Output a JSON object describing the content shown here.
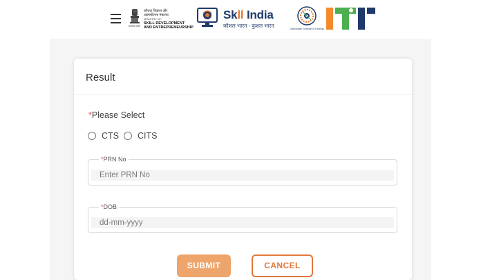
{
  "header": {
    "menu_icon": "hamburger-menu-icon",
    "ministry_logo": {
      "hindi_line1": "कौशल विकास और",
      "hindi_line2": "उद्यमशीलता मंत्रालय",
      "english_line1": "MINISTRY OF",
      "english_line2": "SKILL DEVELOPMENT",
      "english_line3": "AND ENTREPRENEURSHIP",
      "motto": "सत्यमेव जयते"
    },
    "skill_india_logo": {
      "title_part1": "Sk",
      "title_part2": "ll",
      "title_part3": " India",
      "subtitle": "कौशल भारत - कुशल भारत"
    },
    "dgt_logo": {
      "caption": "Directorate General of Training"
    },
    "iti_logo": {
      "text": "ITI",
      "colors": [
        "#f28a2e",
        "#4caf50",
        "#1f3a6b"
      ]
    }
  },
  "card": {
    "title": "Result",
    "please_select_required": "*",
    "please_select_label": "Please Select",
    "radio_options": [
      "CTS",
      "CITS"
    ],
    "prn_field": {
      "required": "*",
      "label": "PRN No",
      "placeholder": "Enter PRN No"
    },
    "dob_field": {
      "required": "*",
      "label": "DOB",
      "placeholder": "dd-mm-yyyy"
    },
    "submit_label": "SUBMIT",
    "cancel_label": "CANCEL"
  },
  "colors": {
    "accent": "#e4773a",
    "submit_bg": "#eea56c",
    "required": "#d9534f",
    "brand_blue": "#1f3a6b"
  }
}
